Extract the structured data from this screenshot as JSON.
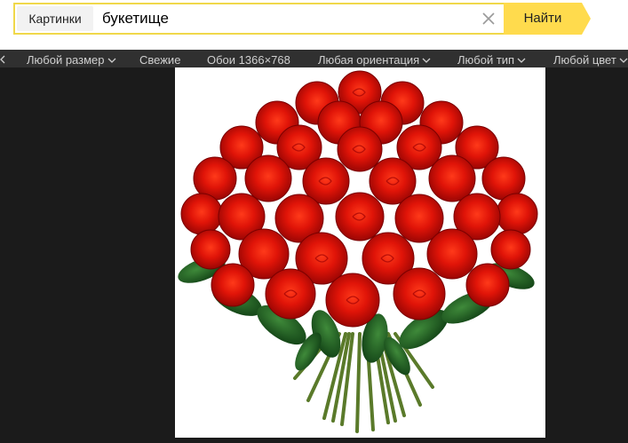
{
  "search": {
    "service_tab": "Картинки",
    "query": "букетище",
    "submit_label": "Найти"
  },
  "filters": [
    {
      "label": "Любой размер",
      "dropdown": true
    },
    {
      "label": "Свежие",
      "dropdown": false
    },
    {
      "label": "Обои 1366×768",
      "dropdown": false
    },
    {
      "label": "Любая ориентация",
      "dropdown": true
    },
    {
      "label": "Любой тип",
      "dropdown": true
    },
    {
      "label": "Любой цвет",
      "dropdown": true
    }
  ],
  "icons": {
    "clear": "close-icon",
    "dropdown": "chevron-down-icon",
    "scroll_left": "chevron-left-icon"
  },
  "colors": {
    "accent": "#ffdb4d",
    "search_border": "#f0d84a",
    "viewer_bg": "#1b1b1b",
    "filter_bar": "#303030"
  }
}
